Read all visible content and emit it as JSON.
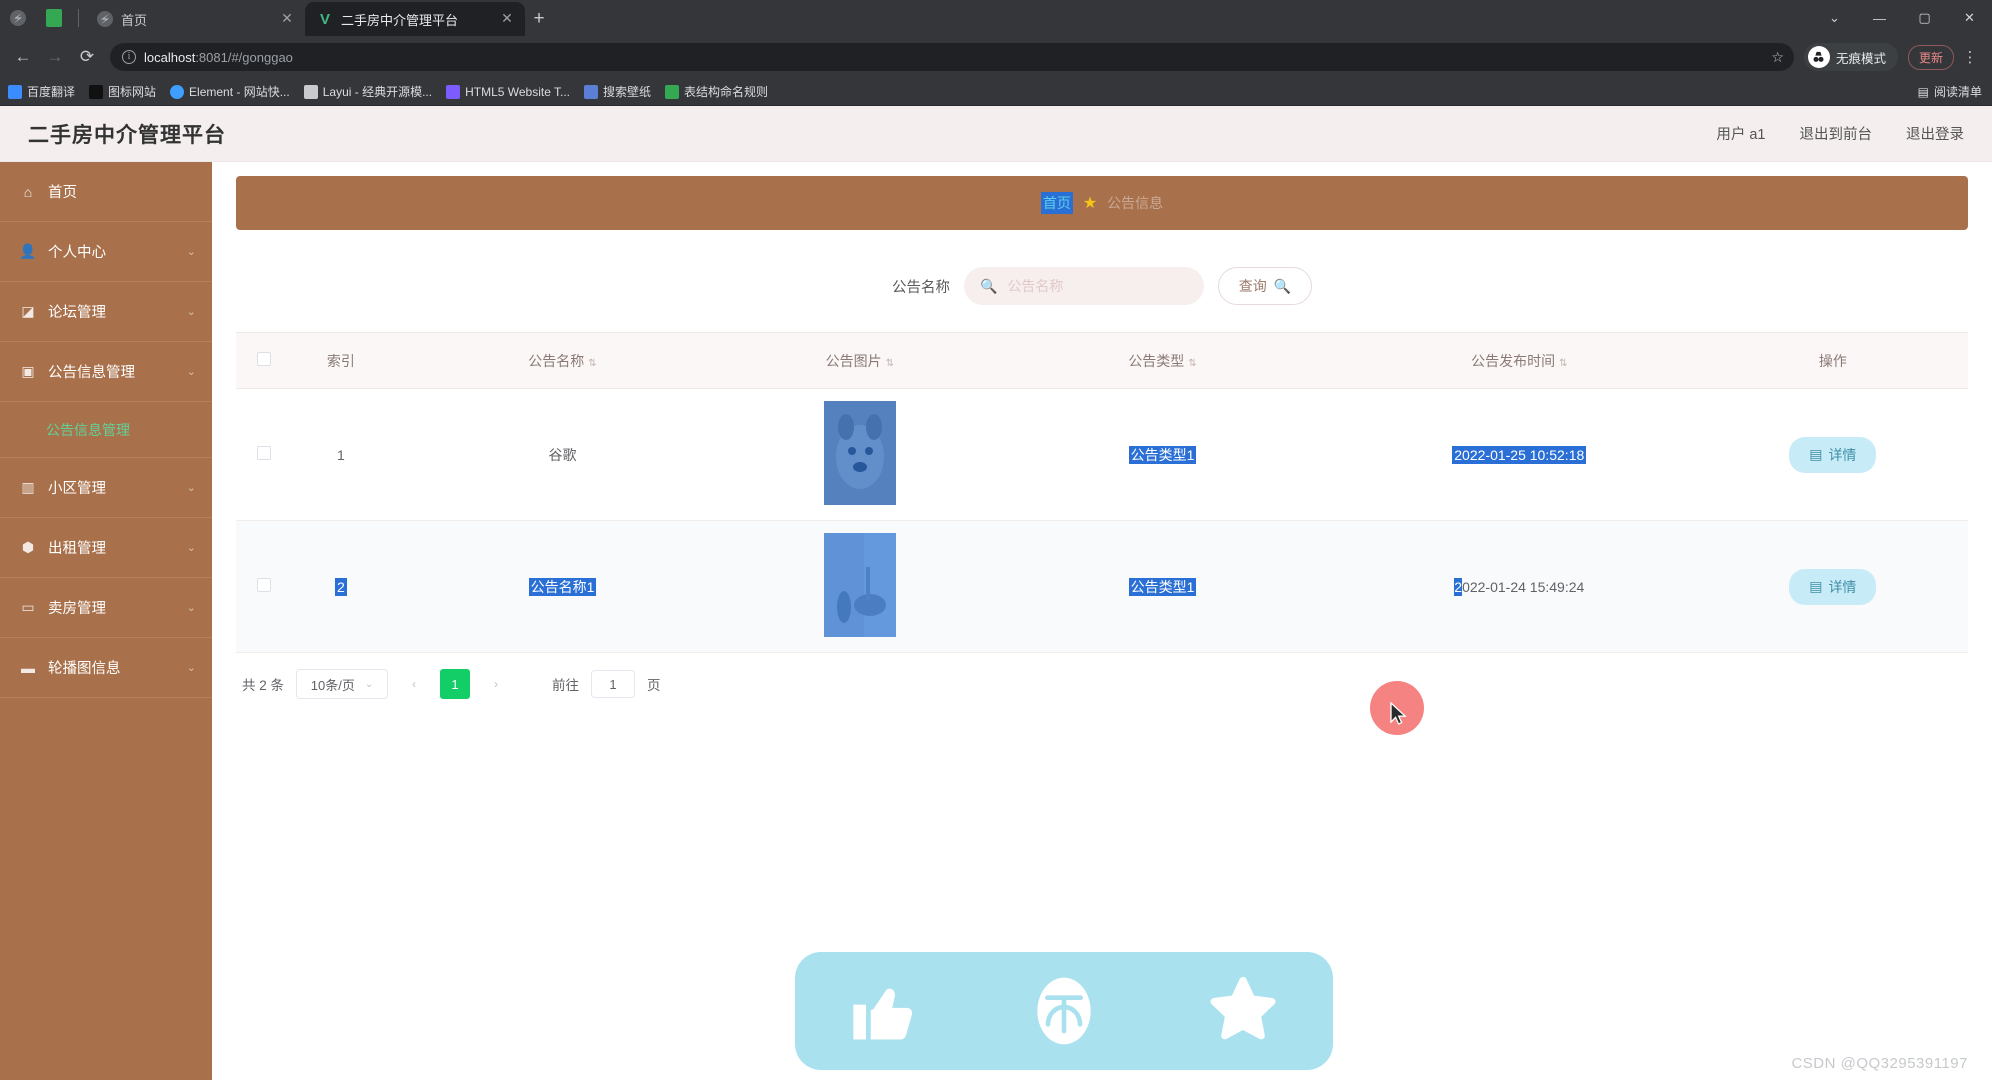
{
  "browser": {
    "tabs": [
      {
        "label": "首页",
        "favicon": "chrome-icon",
        "active": false
      },
      {
        "label": "二手房中介管理平台",
        "favicon": "vue-logo-icon",
        "active": true
      }
    ],
    "new_tab_label": "+",
    "window_controls": [
      "chevron-down",
      "minimize",
      "maximize",
      "close"
    ],
    "nav": {
      "back": "←",
      "forward": "→",
      "reload": "⟳"
    },
    "omnibox": {
      "url_host": "localhost",
      "url_rest": ":8081/#/gonggao",
      "info_icon": "info-icon",
      "star_icon": "star-icon"
    },
    "incognito_label": "无痕模式",
    "update_label": "更新",
    "bookmarks": [
      {
        "label": "百度翻译",
        "color": "#3b8cff"
      },
      {
        "label": "图标网站",
        "color": "#111111"
      },
      {
        "label": "Element - 网站快...",
        "color": "#409eff"
      },
      {
        "label": "Layui - 经典开源模...",
        "color": "#c8cace"
      },
      {
        "label": "HTML5 Website T...",
        "color": "#7c5cff"
      },
      {
        "label": "搜索壁纸",
        "color": "#5b7fd4"
      },
      {
        "label": "表结构命名规则",
        "color": "#34a853"
      }
    ],
    "reading_list": "阅读清单"
  },
  "app": {
    "title": "二手房中介管理平台",
    "header_links": [
      "用户 a1",
      "退出到前台",
      "退出登录"
    ],
    "sidebar": [
      {
        "label": "首页",
        "icon": "home-icon",
        "arrow": false,
        "active": true
      },
      {
        "label": "个人中心",
        "icon": "user-icon",
        "arrow": true
      },
      {
        "label": "论坛管理",
        "icon": "forum-icon",
        "arrow": true
      },
      {
        "label": "公告信息管理",
        "icon": "announcement-icon",
        "arrow": true
      },
      {
        "label": "小区管理",
        "icon": "building-icon",
        "arrow": true
      },
      {
        "label": "出租管理",
        "icon": "rent-icon",
        "arrow": true
      },
      {
        "label": "卖房管理",
        "icon": "sell-icon",
        "arrow": true
      },
      {
        "label": "轮播图信息",
        "icon": "carousel-icon",
        "arrow": true
      }
    ],
    "submenu_label": "公告信息管理",
    "breadcrumb": {
      "home": "首页",
      "star": "★",
      "current": "公告信息"
    },
    "search": {
      "label": "公告名称",
      "placeholder": "公告名称",
      "value": "",
      "search_icon": "search-icon",
      "button_label": "查询",
      "button_icon": "search-icon"
    },
    "table": {
      "columns": [
        {
          "label": "",
          "sortable": false
        },
        {
          "label": "索引",
          "sortable": false
        },
        {
          "label": "公告名称",
          "sortable": true
        },
        {
          "label": "公告图片",
          "sortable": true
        },
        {
          "label": "公告类型",
          "sortable": true
        },
        {
          "label": "公告发布时间",
          "sortable": true
        },
        {
          "label": "操作",
          "sortable": false
        }
      ],
      "rows": [
        {
          "index": "1",
          "name": "谷歌",
          "image_alt": "dog-photo",
          "type": "公告类型1",
          "time": "2022-01-25 10:52:18",
          "action_label": "详情",
          "action_icon": "document-icon",
          "selected": {
            "index": false,
            "name": false,
            "type": true,
            "time": true
          }
        },
        {
          "index": "2",
          "name": "公告名称1",
          "image_alt": "kitchen-photo",
          "type": "公告类型1",
          "time": "2022-01-24 15:49:24",
          "action_label": "详情",
          "action_icon": "document-icon",
          "selected": {
            "index": true,
            "name": true,
            "type": true,
            "time": false
          }
        }
      ]
    },
    "pagination": {
      "total_label": "共 2 条",
      "page_size": "10条/页",
      "prev_icon": "chevron-left-icon",
      "next_icon": "chevron-right-icon",
      "current_page": "1",
      "jump_label": "前往",
      "jump_value": "1",
      "jump_unit": "页"
    },
    "float_bar": [
      {
        "icon": "thumbs-up-icon"
      },
      {
        "icon": "not-icon"
      },
      {
        "icon": "star-icon"
      }
    ],
    "watermark": "CSDN @QQ3295391197"
  }
}
